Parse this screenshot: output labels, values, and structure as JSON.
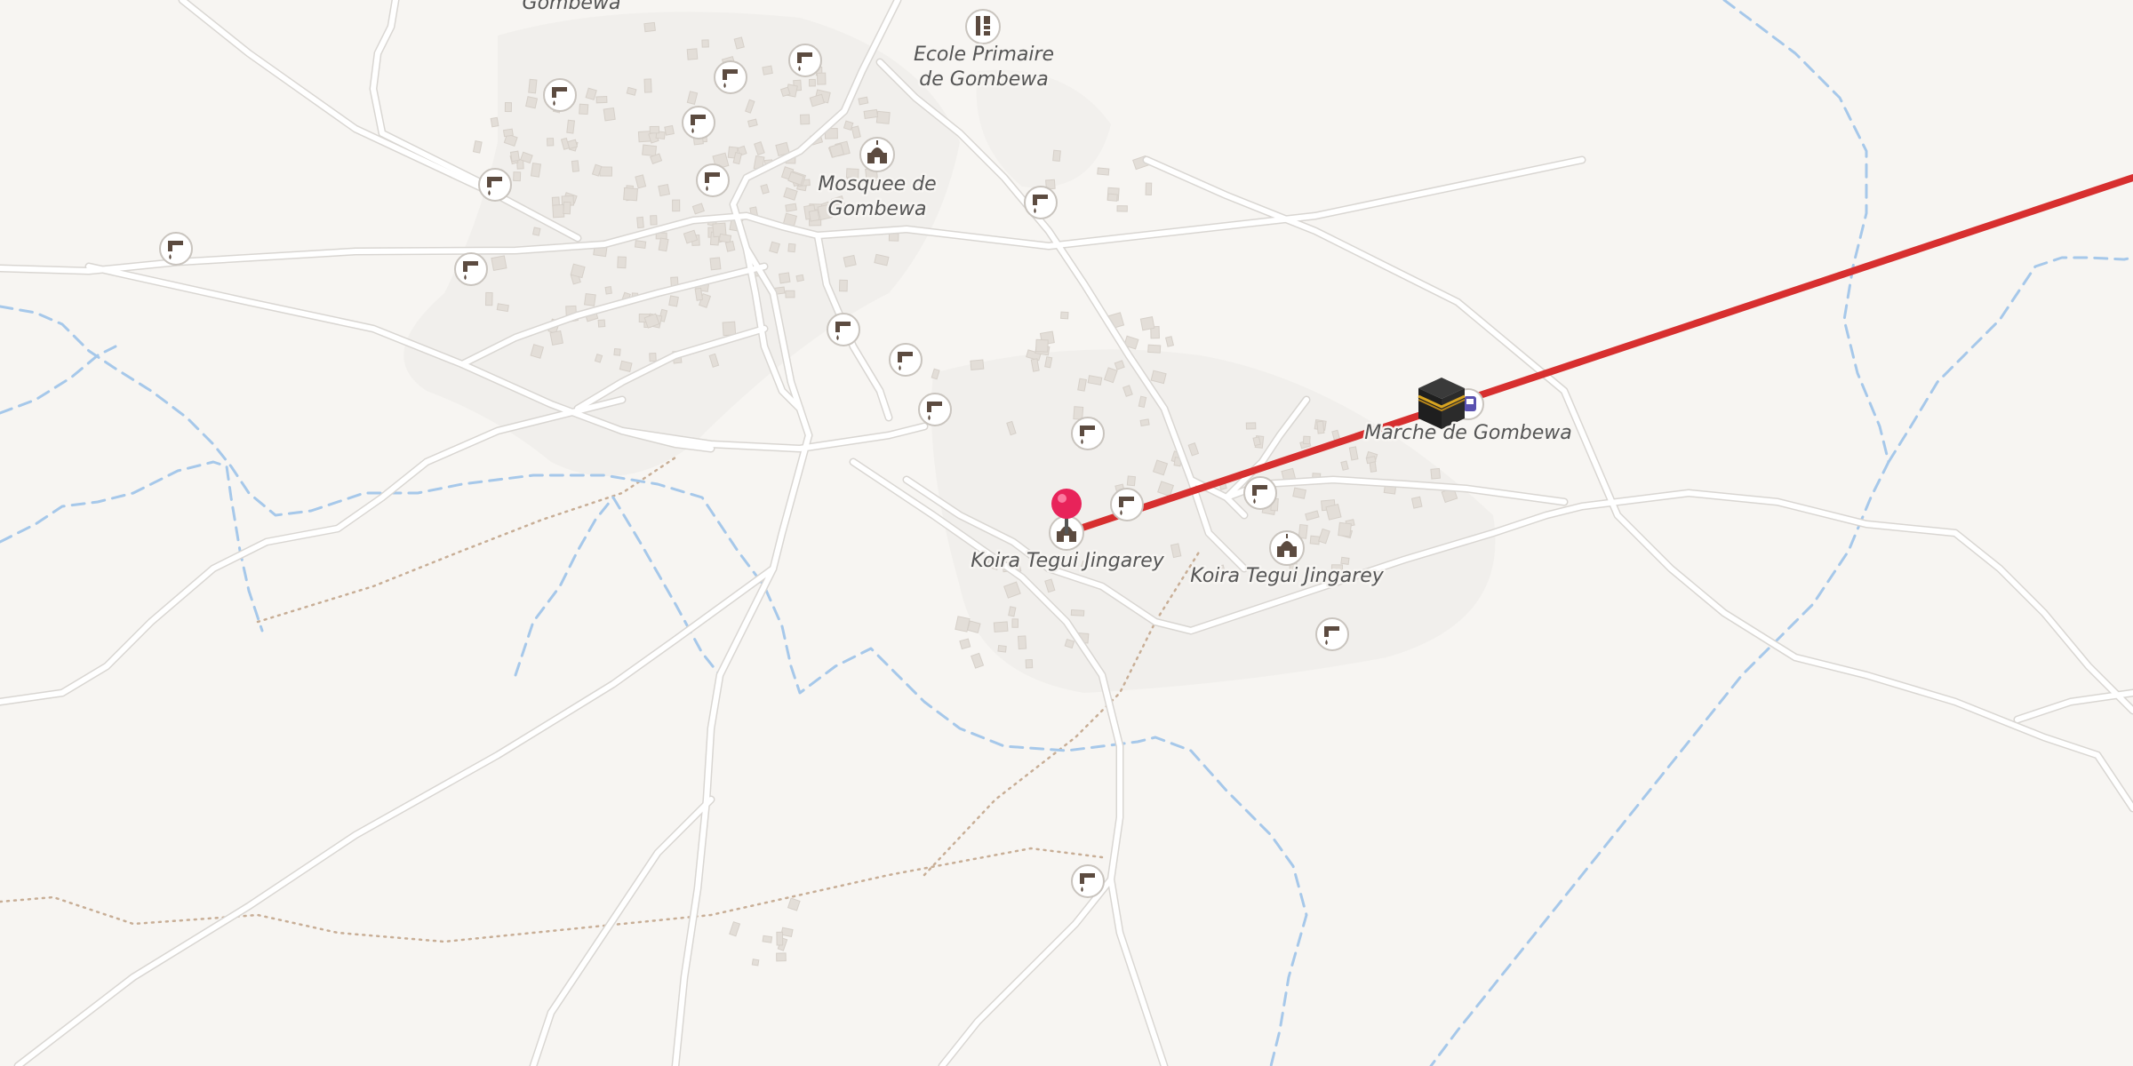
{
  "map": {
    "labels": {
      "gombewa_top": "Gombewa",
      "ecole_line1": "Ecole Primaire",
      "ecole_line2": "de Gombewa",
      "mosquee_line1": "Mosquee de",
      "mosquee_line2": "Gombewa",
      "marche": "Marche de Gombewa",
      "koira1": "Koira Tegui Jingarey",
      "koira2": "Koira Tegui Jingarey"
    },
    "colors": {
      "background": "#f7f5f2",
      "settlement": "#efedea",
      "road": "#ffffff",
      "road_casing": "#d9d6d2",
      "stream": "#a6c8ea",
      "path": "#c8ae96",
      "route": "#d72f2f",
      "pin": "#e8235a",
      "building": "#e3ded8",
      "icon": "#5c4b40"
    },
    "icons": {
      "water_tap": "water-tap-icon",
      "mosque": "mosque-icon",
      "school": "school-icon",
      "kaaba": "kaaba-icon",
      "pin": "map-pin-icon",
      "bus": "bus-stop-icon"
    }
  }
}
